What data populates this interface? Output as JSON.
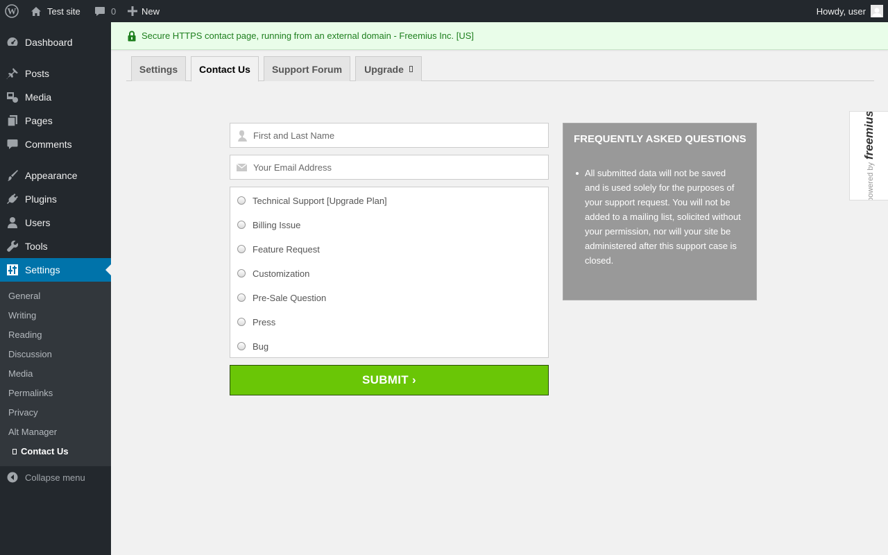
{
  "adminbar": {
    "site_name": "Test site",
    "comments_count": "0",
    "new_label": "New",
    "howdy": "Howdy, user"
  },
  "sidebar": {
    "items": [
      {
        "label": "Dashboard",
        "icon": "dashboard-icon"
      },
      {
        "label": "Posts",
        "icon": "pin-icon"
      },
      {
        "label": "Media",
        "icon": "media-icon"
      },
      {
        "label": "Pages",
        "icon": "pages-icon"
      },
      {
        "label": "Comments",
        "icon": "comment-icon"
      },
      {
        "label": "Appearance",
        "icon": "brush-icon"
      },
      {
        "label": "Plugins",
        "icon": "plug-icon"
      },
      {
        "label": "Users",
        "icon": "user-icon"
      },
      {
        "label": "Tools",
        "icon": "wrench-icon"
      },
      {
        "label": "Settings",
        "icon": "sliders-icon"
      }
    ],
    "submenu": [
      "General",
      "Writing",
      "Reading",
      "Discussion",
      "Media",
      "Permalinks",
      "Privacy",
      "Alt Manager",
      "Contact Us"
    ],
    "collapse": "Collapse menu"
  },
  "notice": {
    "text": "Secure HTTPS contact page, running from an external domain - Freemius Inc. [US]"
  },
  "tabs": [
    {
      "label": "Settings"
    },
    {
      "label": "Contact Us"
    },
    {
      "label": "Support Forum"
    },
    {
      "label": "Upgrade"
    }
  ],
  "form": {
    "name_placeholder": "First and Last Name",
    "email_placeholder": "Your Email Address",
    "topics": [
      "Technical Support [Upgrade Plan]",
      "Billing Issue",
      "Feature Request",
      "Customization",
      "Pre-Sale Question",
      "Press",
      "Bug"
    ],
    "submit_label": "SUBMIT ›"
  },
  "faq": {
    "title": "FREQUENTLY ASKED QUESTIONS",
    "items": [
      "All submitted data will not be saved and is used solely for the purposes of your support request. You will not be added to a mailing list, solicited without your permission, nor will your site be administered after this support case is closed."
    ]
  },
  "powered": {
    "by": "powered by",
    "brand": "freemius"
  },
  "colors": {
    "adminbar_bg": "#23282d",
    "sidebar_current": "#0073aa",
    "submit_green": "#6ac606",
    "notice_bg": "#e9fde9",
    "notice_text": "#1e7f1e",
    "faq_bg": "#999999"
  }
}
